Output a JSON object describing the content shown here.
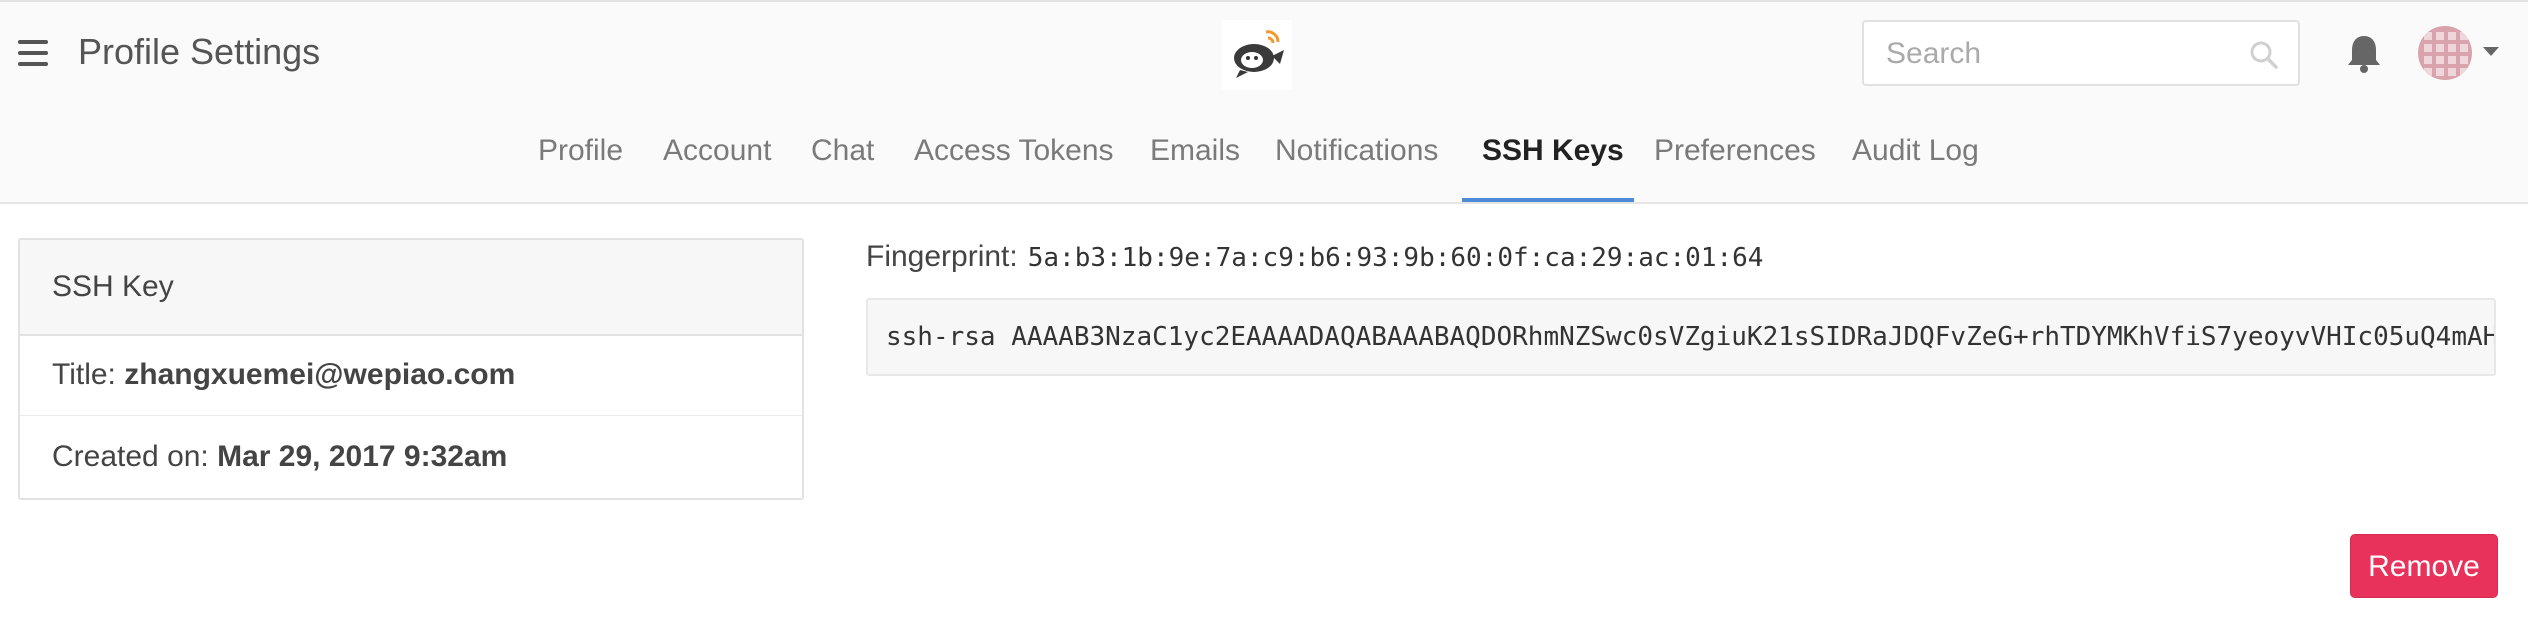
{
  "header": {
    "menu_icon": "hamburger-menu-icon",
    "title": "Profile Settings",
    "logo_icon": "app-logo-icon",
    "search": {
      "placeholder": "Search",
      "icon": "search-icon"
    },
    "notification_icon": "bell-icon",
    "avatar_icon": "user-avatar",
    "dropdown_icon": "chevron-down-icon"
  },
  "tabs": [
    {
      "label": "Profile"
    },
    {
      "label": "Account"
    },
    {
      "label": "Chat"
    },
    {
      "label": "Access Tokens"
    },
    {
      "label": "Emails"
    },
    {
      "label": "Notifications"
    },
    {
      "label": "SSH Keys",
      "active": true
    },
    {
      "label": "Preferences"
    },
    {
      "label": "Audit Log"
    }
  ],
  "key_card": {
    "heading": "SSH Key",
    "title_label": "Title:",
    "title_value": "zhangxuemei@wepiao.com",
    "created_label": "Created on:",
    "created_value": "Mar 29, 2017 9:32am"
  },
  "fingerprint": {
    "label": "Fingerprint:",
    "value": "5a:b3:1b:9e:7a:c9:b6:93:9b:60:0f:ca:29:ac:01:64"
  },
  "public_key": "ssh-rsa AAAAB3NzaC1yc2EAAAADAQABAAABAQDORhmNZSwc0sVZgiuK21sSIDRaJDQFvZeG+rhTDYMKhVfiS7yeoyvVHIc05uQ4mAH",
  "actions": {
    "remove_label": "Remove"
  },
  "colors": {
    "accent": "#4c8bd6",
    "danger": "#e8315b"
  }
}
